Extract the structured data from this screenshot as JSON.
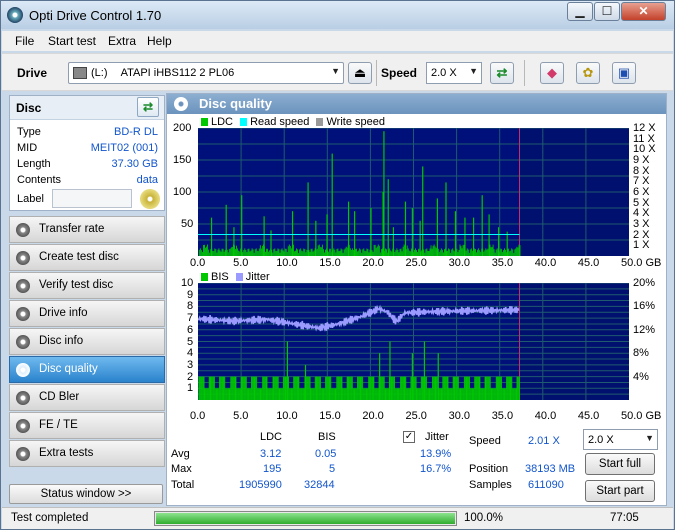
{
  "window": {
    "title": "Opti Drive Control 1.70",
    "min": "▁",
    "max": "☐",
    "close": "✕"
  },
  "menu": [
    "File",
    "Start test",
    "Extra",
    "Help"
  ],
  "toolbar": {
    "drive_label": "Drive",
    "drive_letter": "(L:)",
    "drive_name": "ATAPI iHBS112   2 PL06",
    "speed_label": "Speed",
    "speed_value": "2.0 X",
    "icons": [
      "eject-icon",
      "refresh-icon",
      "erase-icon",
      "settings-icon",
      "save-icon"
    ]
  },
  "disc": {
    "title": "Disc",
    "rows": [
      {
        "label": "Type",
        "value": "BD-R DL"
      },
      {
        "label": "MID",
        "value": "MEIT02 (001)"
      },
      {
        "label": "Length",
        "value": "37.30 GB"
      },
      {
        "label": "Contents",
        "value": "data"
      }
    ],
    "label_field": "Label",
    "label_value": ""
  },
  "nav": [
    {
      "label": "Transfer rate",
      "active": false
    },
    {
      "label": "Create test disc",
      "active": false
    },
    {
      "label": "Verify test disc",
      "active": false
    },
    {
      "label": "Drive info",
      "active": false
    },
    {
      "label": "Disc info",
      "active": false
    },
    {
      "label": "Disc quality",
      "active": true
    },
    {
      "label": "CD Bler",
      "active": false
    },
    {
      "label": "FE / TE",
      "active": false
    },
    {
      "label": "Extra tests",
      "active": false
    }
  ],
  "status_window_label": "Status window >>",
  "panel_title": "Disc quality",
  "chart_data": [
    {
      "type": "bar",
      "legend": [
        "LDC",
        "Read speed",
        "Write speed"
      ],
      "colors": {
        "LDC": "#00c800",
        "Read speed": "#00ffff",
        "Write speed": "#9a9a9a"
      },
      "xlim": [
        0,
        50
      ],
      "xticks": [
        "0.0",
        "5.0",
        "10.0",
        "15.0",
        "20.0",
        "25.0",
        "30.0",
        "35.0",
        "40.0",
        "45.0",
        "50.0 GB"
      ],
      "ylim": [
        0,
        200
      ],
      "yticks": [
        "200",
        "150",
        "100",
        "50"
      ],
      "y2ticks": [
        "12 X",
        "11 X",
        "10 X",
        "9 X",
        "8 X",
        "7 X",
        "6 X",
        "5 X",
        "4 X",
        "3 X",
        "2 X",
        "1 X"
      ],
      "data_end": 37.3,
      "baseline": 12,
      "spikes": [
        [
          1.5,
          60
        ],
        [
          3.2,
          80
        ],
        [
          4.1,
          45
        ],
        [
          5.0,
          95
        ],
        [
          7.6,
          62
        ],
        [
          8.4,
          40
        ],
        [
          10.9,
          70
        ],
        [
          12.7,
          115
        ],
        [
          13.6,
          55
        ],
        [
          14.9,
          65
        ],
        [
          15.5,
          160
        ],
        [
          17.4,
          85
        ],
        [
          18.1,
          70
        ],
        [
          20.0,
          75
        ],
        [
          21.4,
          100
        ],
        [
          21.5,
          195
        ],
        [
          22.0,
          120
        ],
        [
          22.6,
          45
        ],
        [
          24.0,
          85
        ],
        [
          24.8,
          75
        ],
        [
          25.7,
          55
        ],
        [
          26.0,
          140
        ],
        [
          27.7,
          90
        ],
        [
          28.7,
          115
        ],
        [
          29.8,
          70
        ],
        [
          30.9,
          60
        ],
        [
          31.9,
          60
        ],
        [
          32.9,
          95
        ],
        [
          33.7,
          65
        ],
        [
          34.8,
          45
        ],
        [
          35.8,
          38
        ]
      ],
      "read_speed": 2.01
    },
    {
      "type": "bar",
      "legend": [
        "BIS",
        "Jitter"
      ],
      "colors": {
        "BIS": "#00c800",
        "Jitter": "#9a9aff"
      },
      "xlim": [
        0,
        50
      ],
      "xticks": [
        "0.0",
        "5.0",
        "10.0",
        "15.0",
        "20.0",
        "25.0",
        "30.0",
        "35.0",
        "40.0",
        "45.0",
        "50.0 GB"
      ],
      "ylim": [
        0,
        10
      ],
      "yticks": [
        "10",
        "9",
        "8",
        "7",
        "6",
        "5",
        "4",
        "3",
        "2",
        "1"
      ],
      "y2ticks": [
        "20%",
        "16%",
        "12%",
        "8%",
        "4%"
      ],
      "data_end": 37.3,
      "bis_spikes": [
        [
          10.3,
          5
        ],
        [
          12.4,
          3
        ],
        [
          21.0,
          4
        ],
        [
          22.2,
          5
        ],
        [
          24.8,
          4
        ],
        [
          26.2,
          5
        ],
        [
          27.8,
          4
        ]
      ],
      "jitter_curve": [
        [
          0,
          13.9
        ],
        [
          4,
          13.5
        ],
        [
          8,
          13.8
        ],
        [
          12,
          12.8
        ],
        [
          14,
          12.3
        ],
        [
          16,
          12.9
        ],
        [
          19,
          14.3
        ],
        [
          21,
          15.6
        ],
        [
          22,
          15.0
        ],
        [
          23,
          13.4
        ],
        [
          24,
          14.9
        ],
        [
          27,
          15.1
        ],
        [
          30,
          15.2
        ],
        [
          34,
          15.3
        ],
        [
          37.3,
          15.4
        ]
      ]
    }
  ],
  "stats": {
    "col_ldc": "LDC",
    "col_bis": "BIS",
    "jitter_label": "Jitter",
    "jitter_checked": "✓",
    "rows": [
      {
        "label": "Avg",
        "ldc": "3.12",
        "bis": "0.05",
        "jitter": "13.9%"
      },
      {
        "label": "Max",
        "ldc": "195",
        "bis": "5",
        "jitter": "16.7%"
      },
      {
        "label": "Total",
        "ldc": "1905990",
        "bis": "32844",
        "jitter": ""
      }
    ],
    "speed_label": "Speed",
    "speed_value": "2.01 X",
    "position_label": "Position",
    "position_value": "38193 MB",
    "samples_label": "Samples",
    "samples_value": "611090",
    "speed_select": "2.0 X",
    "start_full": "Start full",
    "start_part": "Start part"
  },
  "statusbar": {
    "text": "Test completed",
    "progress_value": 100,
    "progress_label": "100.0%",
    "elapsed": "77:05"
  }
}
